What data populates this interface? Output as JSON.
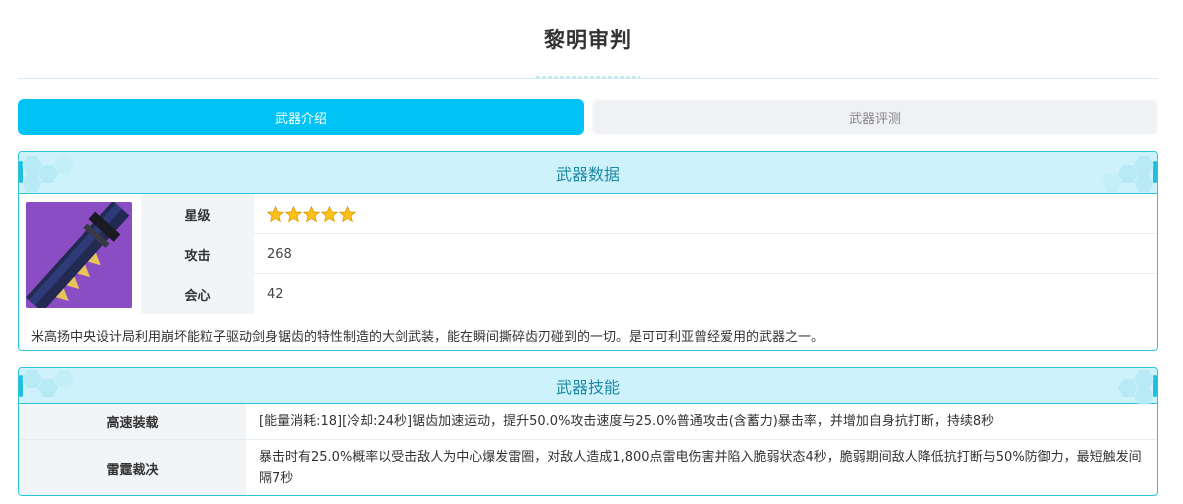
{
  "page": {
    "title": "黎明审判"
  },
  "tabs": [
    {
      "label": "武器介绍",
      "active": true
    },
    {
      "label": "武器评测",
      "active": false
    }
  ],
  "weapon_data": {
    "header": "武器数据",
    "stats": [
      {
        "label": "星级",
        "value": "",
        "stars": 5
      },
      {
        "label": "攻击",
        "value": "268"
      },
      {
        "label": "会心",
        "value": "42"
      }
    ],
    "description": "米高扬中央设计局利用崩坏能粒子驱动剑身锯齿的特性制造的大剑武装，能在瞬间撕碎齿刃碰到的一切。是可可利亚曾经爱用的武器之一。"
  },
  "weapon_skills": {
    "header": "武器技能",
    "skills": [
      {
        "name": "高速装载",
        "desc": "[能量消耗:18][冷却:24秒]锯齿加速运动，提升50.0%攻击速度与25.0%普通攻击(含蓄力)暴击率，并增加自身抗打断，持续8秒"
      },
      {
        "name": "雷霆裁决",
        "desc": "暴击时有25.0%概率以受击敌人为中心爆发雷圈，对敌人造成1,800点雷电伤害并陷入脆弱状态4秒，脆弱期间敌人降低抗打断与50%防御力，最短触发间隔7秒"
      }
    ]
  },
  "colors": {
    "accent": "#00c3f5",
    "header_bg": "#cdf2fb",
    "border": "#29c4dc",
    "label_bg": "#f2f5f8",
    "star": "#ffc21a"
  },
  "icons": {
    "star": "star-icon",
    "weapon": "weapon-image"
  }
}
